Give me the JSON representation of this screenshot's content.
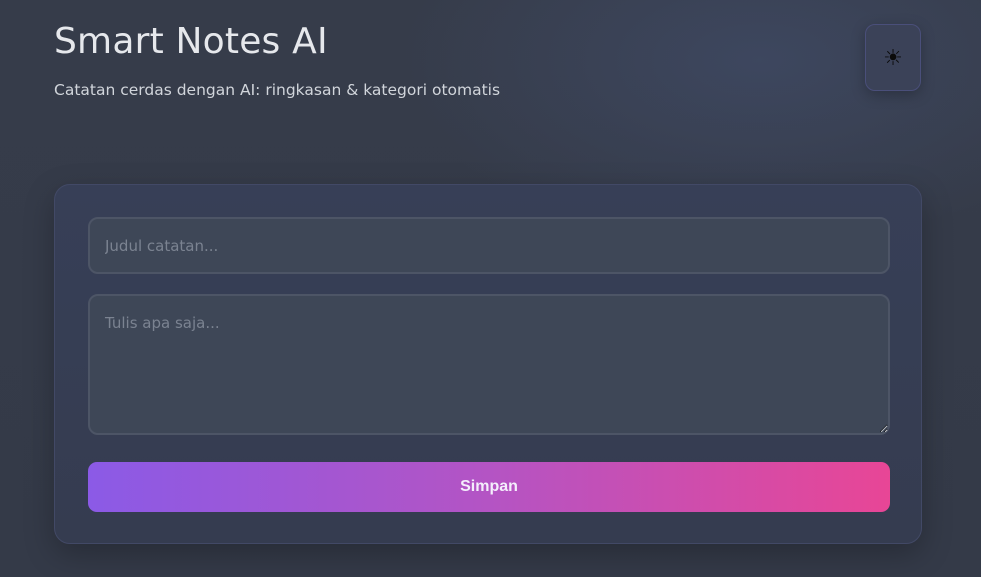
{
  "header": {
    "title": "Smart Notes AI",
    "subtitle": "Catatan cerdas dengan AI: ringkasan & kategori otomatis"
  },
  "theme_toggle": {
    "icon": "sun-icon",
    "glyph": "☀"
  },
  "note_form": {
    "title_placeholder": "Judul catatan...",
    "title_value": "",
    "content_placeholder": "Tulis apa saja...",
    "content_value": "",
    "save_label": "Simpan"
  },
  "colors": {
    "accent_start": "#8b5ae6",
    "accent_end": "#e84696",
    "background": "#363c4a",
    "card": "#373f57"
  }
}
